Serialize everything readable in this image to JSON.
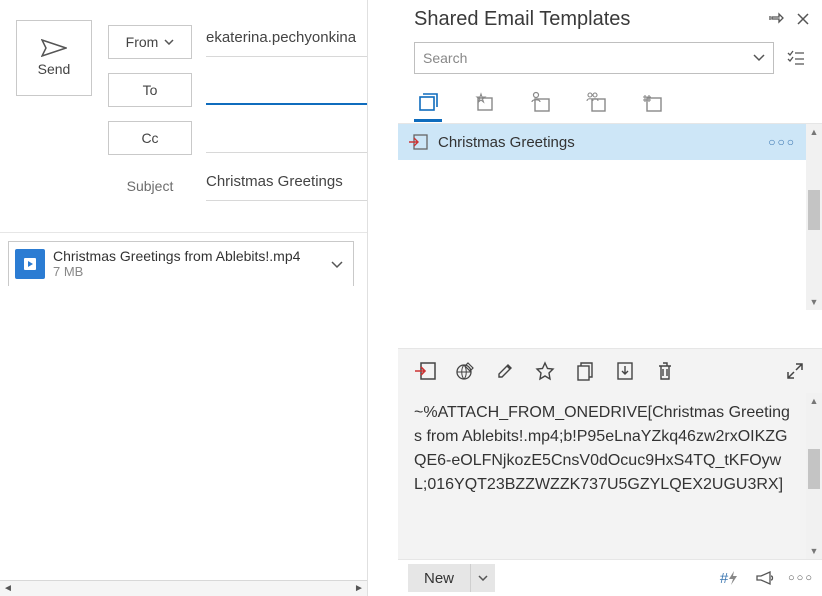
{
  "compose": {
    "send_label": "Send",
    "from_label": "From",
    "from_value": "ekaterina.pechyonkina",
    "to_label": "To",
    "to_value": "",
    "cc_label": "Cc",
    "cc_value": "",
    "subject_label": "Subject",
    "subject_value": "Christmas Greetings",
    "attachment": {
      "name": "Christmas Greetings from Ablebits!.mp4",
      "size": "7 MB"
    }
  },
  "panel": {
    "title": "Shared Email Templates",
    "search_placeholder": "Search",
    "selected_template": "Christmas Greetings",
    "preview_text": "~%ATTACH_FROM_ONEDRIVE[Christmas Greetings from Ablebits!.mp4;b!P95eLnaYZkq46zw2rxOIKZGQE6-eOLFNjkozE5CnsV0dOcuc9HxS4TQ_tKFOywL;016YQT23BZZWZZK737U5GZYLQEX2UGU3RX]",
    "new_label": "New"
  }
}
